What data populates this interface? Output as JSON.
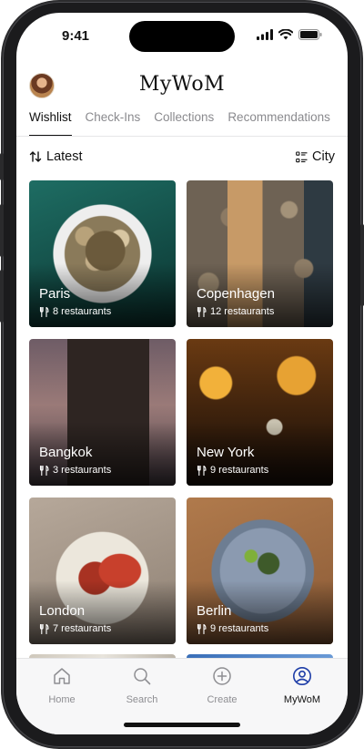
{
  "status": {
    "time": "9:41"
  },
  "header": {
    "title": "MyWoM"
  },
  "tabs": [
    {
      "label": "Wishlist",
      "active": true
    },
    {
      "label": "Check-Ins",
      "active": false
    },
    {
      "label": "Collections",
      "active": false
    },
    {
      "label": "Recommendations",
      "active": false
    }
  ],
  "sort": {
    "label": "Latest",
    "filter_label": "City"
  },
  "cards": [
    {
      "city": "Paris",
      "count": "8 restaurants"
    },
    {
      "city": "Copenhagen",
      "count": "12 restaurants"
    },
    {
      "city": "Bangkok",
      "count": "3 restaurants"
    },
    {
      "city": "New York",
      "count": "9 restaurants"
    },
    {
      "city": "London",
      "count": "7 restaurants"
    },
    {
      "city": "Berlin",
      "count": "9 restaurants"
    }
  ],
  "tabbar": {
    "home": "Home",
    "search": "Search",
    "create": "Create",
    "profile": "MyWoM"
  },
  "icons": {
    "sort": "sort-arrows-icon",
    "filter": "list-filter-icon",
    "restaurant": "fork-knife-icon"
  }
}
